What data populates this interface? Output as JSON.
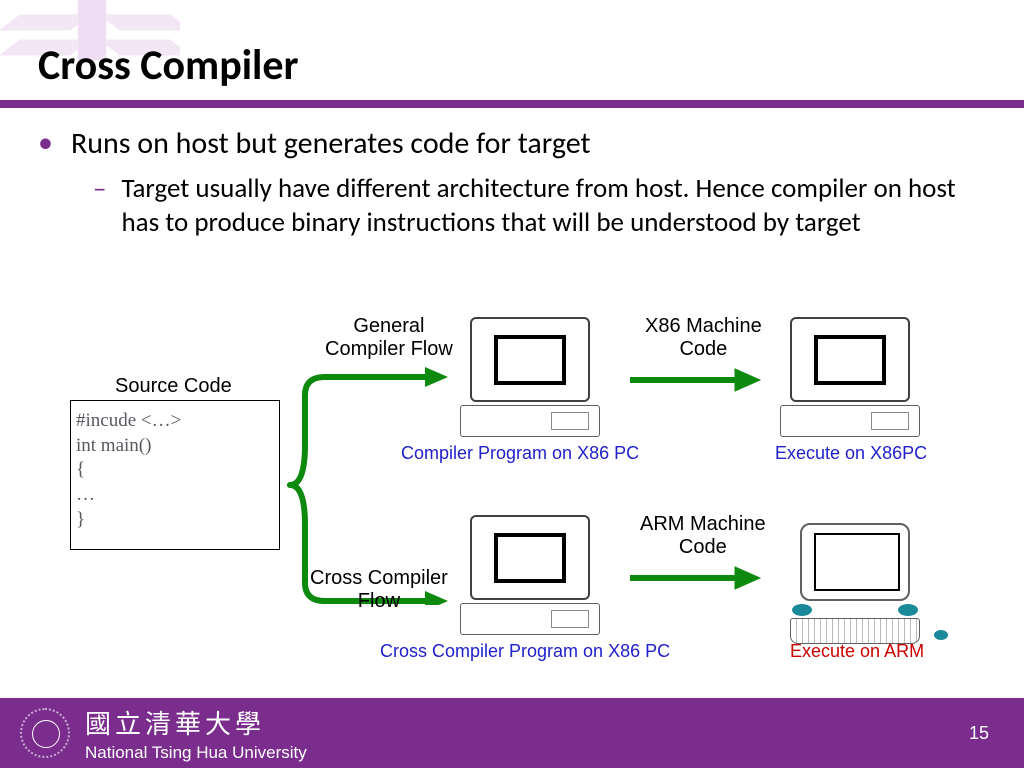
{
  "title": "Cross Compiler",
  "bullets": {
    "main": "Runs on host but generates code for target",
    "sub": "Target usually have different architecture from host. Hence compiler on host has to produce binary instructions that will be understood by target"
  },
  "diagram": {
    "source_label": "Source Code",
    "source_code": {
      "l1": "#incude <…>",
      "l2": "int main()",
      "l3": "{",
      "l4": "…",
      "l5": "}"
    },
    "general_flow": "General\nCompiler Flow",
    "cross_flow": "Cross Compiler\nFlow",
    "x86_code": "X86 Machine\nCode",
    "arm_code": "ARM Machine\nCode",
    "cap_compile_x86": "Compiler Program on X86 PC",
    "cap_exec_x86": "Execute on X86PC",
    "cap_cross_compile": "Cross Compiler Program on X86 PC",
    "cap_exec_arm": "Execute on ARM"
  },
  "footer": {
    "university_cn": "國立清華大學",
    "university_en": "National Tsing Hua University",
    "page": "15"
  },
  "colors": {
    "purple": "#7b2d8e",
    "green": "#0d8a0d",
    "blue": "#2020cc",
    "red": "#cc0000"
  }
}
